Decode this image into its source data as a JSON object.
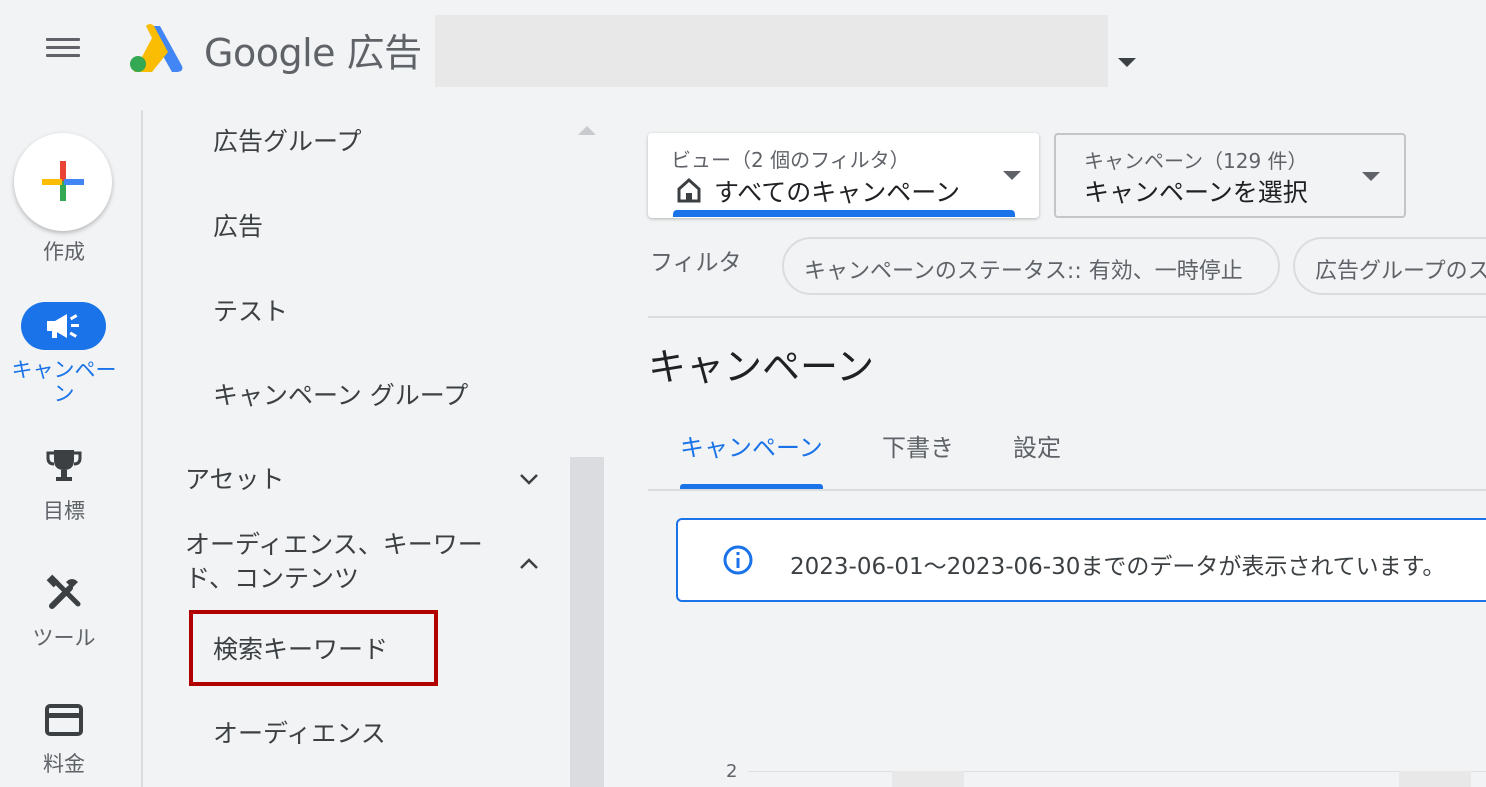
{
  "header": {
    "brand": "Google 広告"
  },
  "rail": {
    "create_label": "作成",
    "campaigns_label": "キャンペー\nン",
    "goals_label": "目標",
    "tools_label": "ツール",
    "billing_label": "料金",
    "icons": [
      "plus-icon",
      "megaphone-icon",
      "trophy-icon",
      "tools-icon",
      "credit-card-icon"
    ]
  },
  "nav": {
    "items": [
      {
        "label": "広告グループ"
      },
      {
        "label": "広告"
      },
      {
        "label": "テスト"
      },
      {
        "label": "キャンペーン グループ"
      }
    ],
    "assets_label": "アセット",
    "audience_section_label": "オーディエンス、キーワード、コンテンツ",
    "audience_line1": "オーディエンス、キーワー",
    "audience_line2": "ド、コンテンツ",
    "search_keywords_label": "検索キーワード",
    "audiences_label": "オーディエンス"
  },
  "main": {
    "view": {
      "small": "ビュー（2 個のフィルタ）",
      "value": "すべてのキャンペーン"
    },
    "campaign_select": {
      "small": "キャンペーン（129 件）",
      "value": "キャンペーンを選択"
    },
    "filter_label": "フィルタ",
    "chips": [
      "キャンペーンのステータス:: 有効、一時停止",
      "広告グループのステータス"
    ],
    "page_title": "キャンペーン",
    "tabs": [
      {
        "label": "キャンペーン",
        "active": true
      },
      {
        "label": "下書き",
        "active": false
      },
      {
        "label": "設定",
        "active": false
      }
    ],
    "info_text": "2023-06-01～2023-06-30までのデータが表示されています。",
    "chart_axis_label": "2"
  },
  "colors": {
    "accent": "#1a73e8",
    "highlight": "#b00000",
    "background": "#f1f3f4"
  }
}
